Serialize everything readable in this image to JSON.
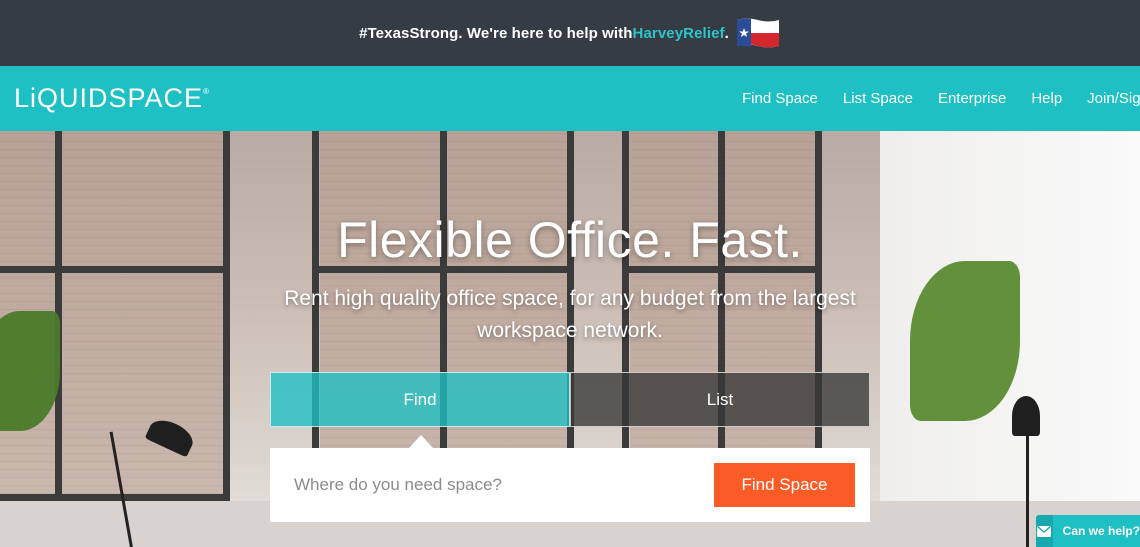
{
  "announcement": {
    "prefix": "#TexasStrong. We're here to help with ",
    "link": "HarveyRelief",
    "suffix": ".",
    "flag_icon": "texas-flag-icon"
  },
  "nav": {
    "logo": "LiQUIDSPACE",
    "logo_mark": "®",
    "links": [
      "Find Space",
      "List Space",
      "Enterprise",
      "Help",
      "Join/Sign In"
    ]
  },
  "hero": {
    "headline": "Flexible Office. Fast.",
    "subline": "Rent high quality office space, for any budget from the largest workspace network."
  },
  "tabs": {
    "find": "Find",
    "list": "List"
  },
  "search": {
    "placeholder": "Where do you need space?",
    "value": "",
    "button": "Find Space"
  },
  "chat": {
    "label": "Can we help?",
    "icon": "envelope-icon"
  },
  "colors": {
    "brand": "#1ec0c4",
    "accent": "#fb5b27",
    "topbar": "#353c44"
  }
}
